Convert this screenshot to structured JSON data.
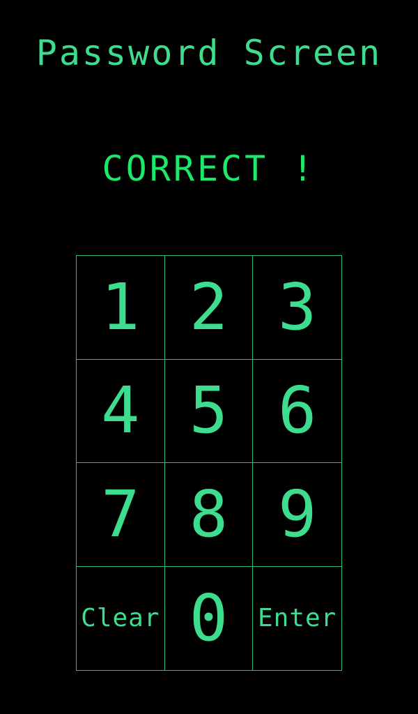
{
  "header": {
    "title": "Password Screen"
  },
  "status": {
    "message": "CORRECT !"
  },
  "keypad": {
    "keys": [
      {
        "label": "1"
      },
      {
        "label": "2"
      },
      {
        "label": "3"
      },
      {
        "label": "4"
      },
      {
        "label": "5"
      },
      {
        "label": "6"
      },
      {
        "label": "7"
      },
      {
        "label": "8"
      },
      {
        "label": "9"
      },
      {
        "label": "Clear"
      },
      {
        "label": "0"
      },
      {
        "label": "Enter"
      }
    ]
  },
  "colors": {
    "background": "#000000",
    "text": "#3ddc8f",
    "status": "#1ee86a",
    "grid_line": "#2fbf7f"
  }
}
